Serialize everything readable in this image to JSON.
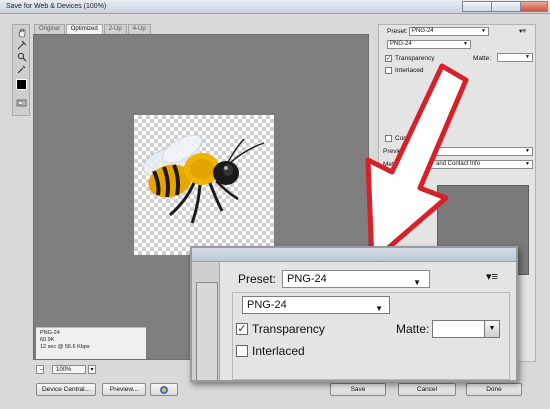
{
  "window": {
    "title": "Save for Web & Devices (100%)"
  },
  "tabs": [
    "Original",
    "Optimized",
    "2-Up",
    "4-Up"
  ],
  "active_tab": "Optimized",
  "tools": [
    "hand-icon",
    "slice-select-icon",
    "zoom-icon",
    "eyedropper-icon",
    "color-swatch-icon",
    "toggle-slices-icon"
  ],
  "preview_info": {
    "format": "PNG-24",
    "size": "60.9K",
    "time": "12 sec @ 56.6 Kbps"
  },
  "zoom": {
    "value": "100%"
  },
  "buttons": {
    "device_central": "Device Central...",
    "preview": "Preview...",
    "save": "Save",
    "cancel": "Cancel",
    "done": "Done"
  },
  "settings": {
    "preset_label": "Preset:",
    "preset_value": "PNG-24",
    "format_value": "PNG-24",
    "transparency_label": "Transparency",
    "transparency_checked": true,
    "interlaced_label": "Interlaced",
    "interlaced_checked": false,
    "matte_label": "Matte:",
    "convert_label": "Conv",
    "preview_label": "Previe",
    "metadata_label": "Metad",
    "metadata_value": "and Contact Info",
    "color_table_label": "Co"
  },
  "inset": {
    "preset_label": "Preset:",
    "preset_value": "PNG-24",
    "format_value": "PNG-24",
    "transparency_label": "Transparency",
    "interlaced_label": "Interlaced",
    "matte_label": "Matte:"
  },
  "colors": {
    "arrow_red": "#d8202a",
    "preview_bg": "#7f7f7f",
    "panel_bg": "#e4e4e4"
  }
}
